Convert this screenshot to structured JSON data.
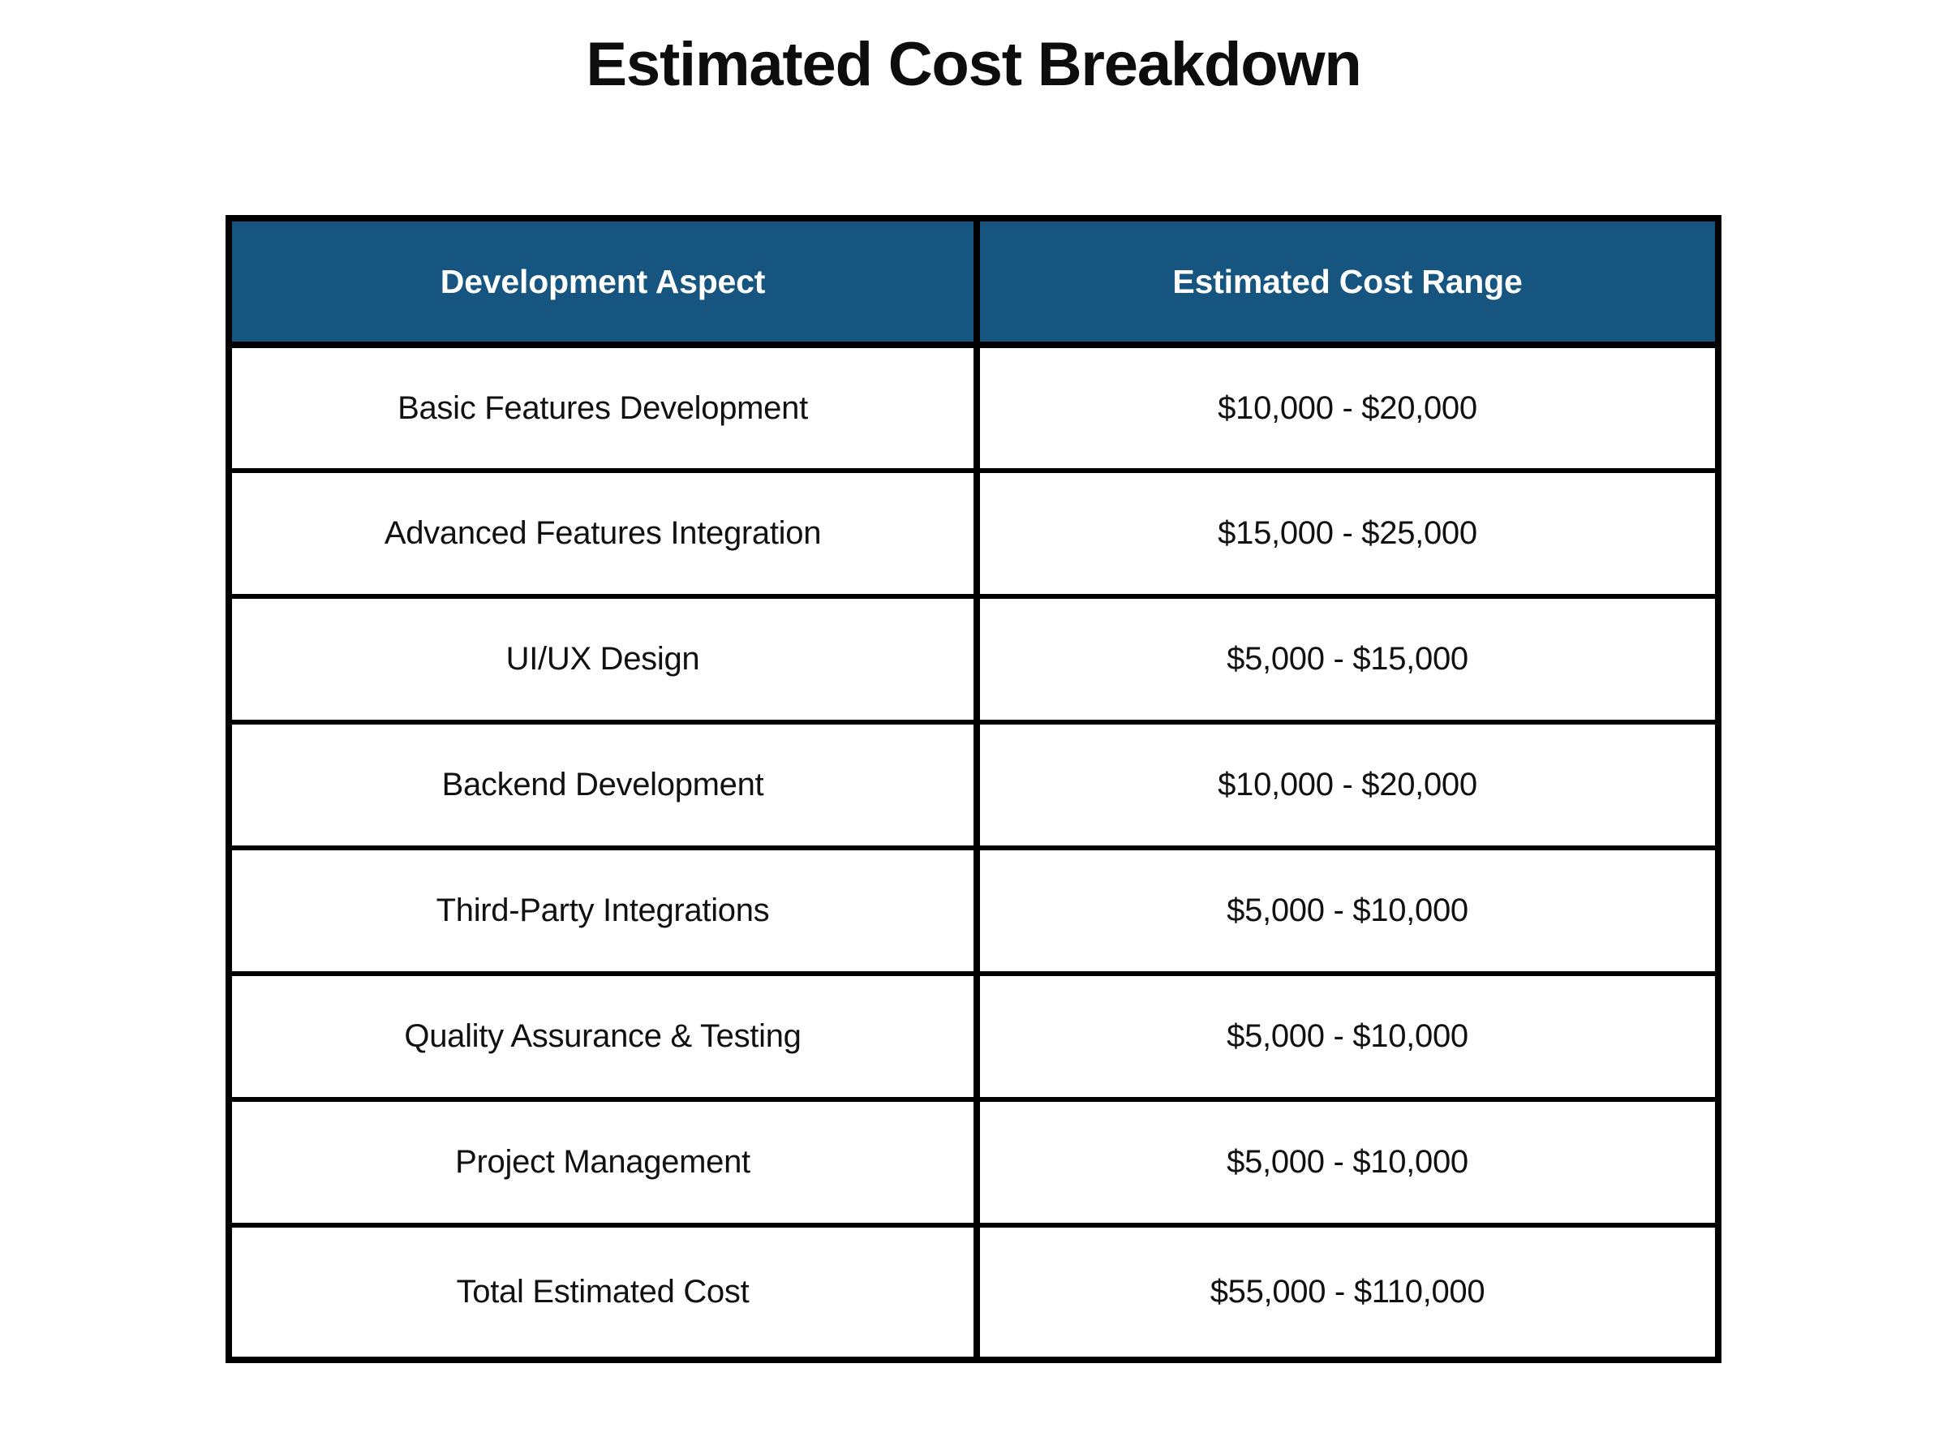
{
  "page": {
    "title": "Estimated Cost Breakdown",
    "background_color": "#ffffff",
    "header_color": "#15557f",
    "border_color": "#000000",
    "text_color": "#111111",
    "header_text_color": "#ffffff"
  },
  "table": {
    "columns": [
      {
        "key": "aspect",
        "label": "Development Aspect"
      },
      {
        "key": "cost",
        "label": "Estimated Cost Range"
      }
    ],
    "rows": [
      {
        "aspect": "Basic Features Development",
        "cost": "$10,000 - $20,000"
      },
      {
        "aspect": "Advanced Features Integration",
        "cost": "$15,000 - $25,000"
      },
      {
        "aspect": "UI/UX Design",
        "cost": "$5,000 - $15,000"
      },
      {
        "aspect": "Backend Development",
        "cost": "$10,000 - $20,000"
      },
      {
        "aspect": "Third-Party Integrations",
        "cost": "$5,000 - $10,000"
      },
      {
        "aspect": "Quality Assurance & Testing",
        "cost": "$5,000 - $10,000"
      },
      {
        "aspect": "Project Management",
        "cost": "$5,000 - $10,000"
      },
      {
        "aspect": "Total Estimated Cost",
        "cost": "$55,000 - $110,000"
      }
    ]
  },
  "chart_data": {
    "type": "table",
    "title": "Estimated Cost Breakdown",
    "columns": [
      "Development Aspect",
      "Estimated Cost Range"
    ],
    "rows": [
      [
        "Basic Features Development",
        "$10,000 - $20,000"
      ],
      [
        "Advanced Features Integration",
        "$15,000 - $25,000"
      ],
      [
        "UI/UX Design",
        "$5,000 - $15,000"
      ],
      [
        "Backend Development",
        "$10,000 - $20,000"
      ],
      [
        "Third-Party Integrations",
        "$5,000 - $10,000"
      ],
      [
        "Quality Assurance & Testing",
        "$5,000 - $10,000"
      ],
      [
        "Project Management",
        "$5,000 - $10,000"
      ],
      [
        "Total Estimated Cost",
        "$55,000 - $110,000"
      ]
    ],
    "cost_low": [
      10000,
      15000,
      5000,
      10000,
      5000,
      5000,
      5000,
      55000
    ],
    "cost_high": [
      20000,
      25000,
      15000,
      20000,
      10000,
      10000,
      10000,
      110000
    ],
    "currency": "USD",
    "xlabel": "",
    "ylabel": ""
  }
}
